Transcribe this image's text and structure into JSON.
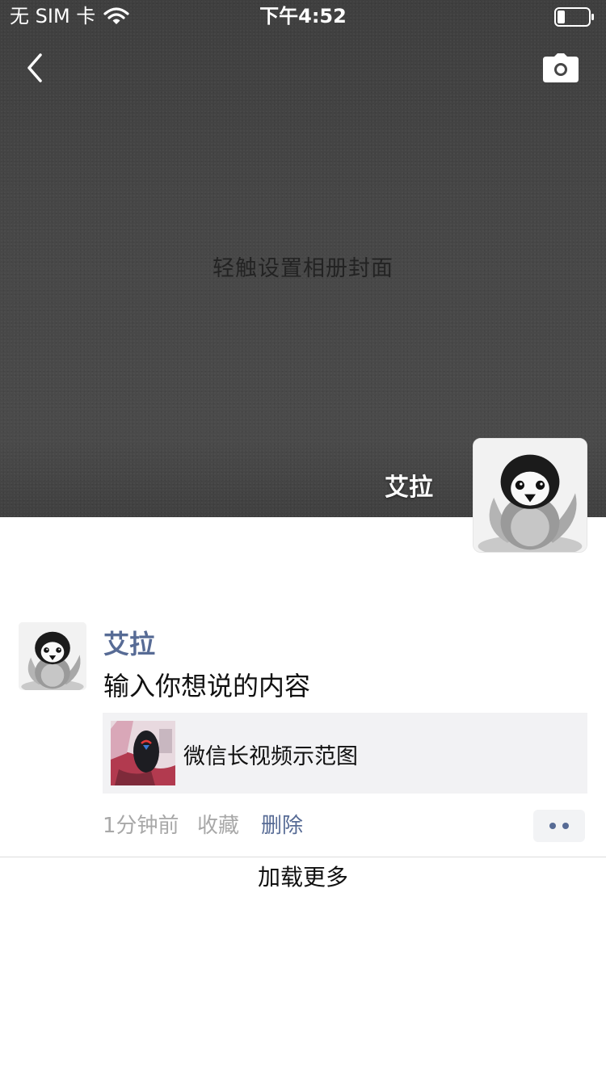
{
  "status_bar": {
    "carrier": "无 SIM 卡",
    "time": "下午4:52",
    "battery_level": 0.25
  },
  "nav": {
    "back_icon": "chevron-left-icon",
    "camera_icon": "camera-icon"
  },
  "cover": {
    "hint": "轻触设置相册封面"
  },
  "profile": {
    "name": "艾拉",
    "avatar": "penguin-avatar"
  },
  "posts": [
    {
      "author": "艾拉",
      "text": "输入你想说的内容",
      "link_card": {
        "title": "微信长视频示范图",
        "thumbnail": "video-thumbnail"
      },
      "time": "1分钟前",
      "favorite_label": "收藏",
      "delete_label": "删除"
    }
  ],
  "load_more": "加载更多",
  "colors": {
    "link_blue": "#576b95",
    "meta_gray": "#a8a8a8",
    "card_bg": "#f2f2f4",
    "cover_bg": "#464646"
  }
}
